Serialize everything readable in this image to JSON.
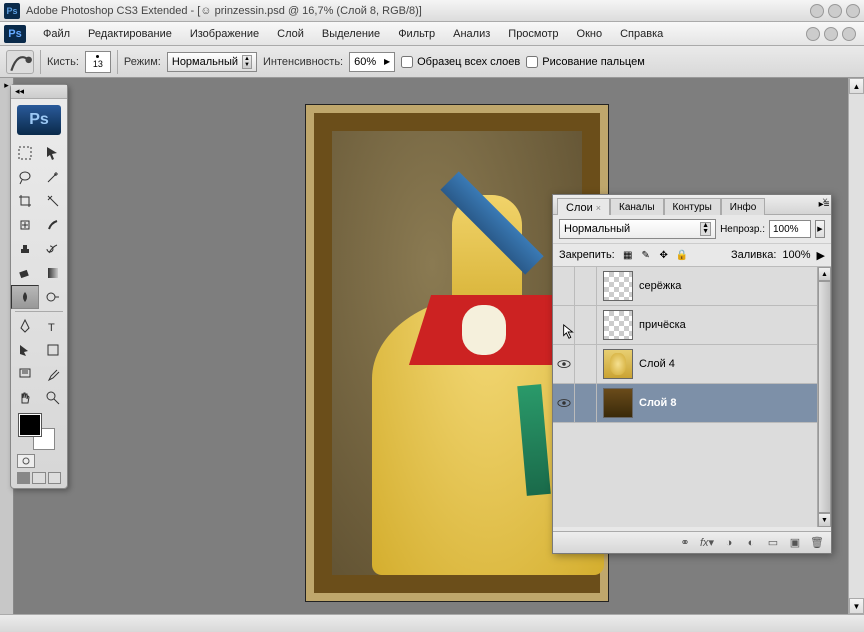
{
  "titlebar": {
    "app": "Adobe Photoshop CS3 Extended",
    "doc": "[☺ prinzessin.psd @ 16,7% (Слой 8, RGB/8)]"
  },
  "menu": {
    "items": [
      "Файл",
      "Редактирование",
      "Изображение",
      "Слой",
      "Выделение",
      "Фильтр",
      "Анализ",
      "Просмотр",
      "Окно",
      "Справка"
    ]
  },
  "options": {
    "brush_label": "Кисть:",
    "brush_size": "13",
    "mode_label": "Режим:",
    "mode_value": "Нормальный",
    "strength_label": "Интенсивность:",
    "strength_value": "60%",
    "sample_all": "Образец всех слоев",
    "finger": "Рисование пальцем"
  },
  "panel": {
    "tabs": [
      "Слои",
      "Каналы",
      "Контуры",
      "Инфо"
    ],
    "blend_mode": "Нормальный",
    "opacity_label": "Непрозр.:",
    "opacity_value": "100%",
    "lock_label": "Закрепить:",
    "fill_label": "Заливка:",
    "fill_value": "100%",
    "layers": [
      {
        "name": "серёжка",
        "visible": false,
        "transp": true,
        "sel": false,
        "thumb": "transp"
      },
      {
        "name": "причёска",
        "visible": false,
        "transp": true,
        "sel": false,
        "thumb": "transp"
      },
      {
        "name": "Слой 4",
        "visible": true,
        "transp": false,
        "sel": false,
        "thumb": "dress-t"
      },
      {
        "name": "Слой 8",
        "visible": true,
        "transp": false,
        "sel": true,
        "thumb": "frame-t"
      }
    ]
  }
}
